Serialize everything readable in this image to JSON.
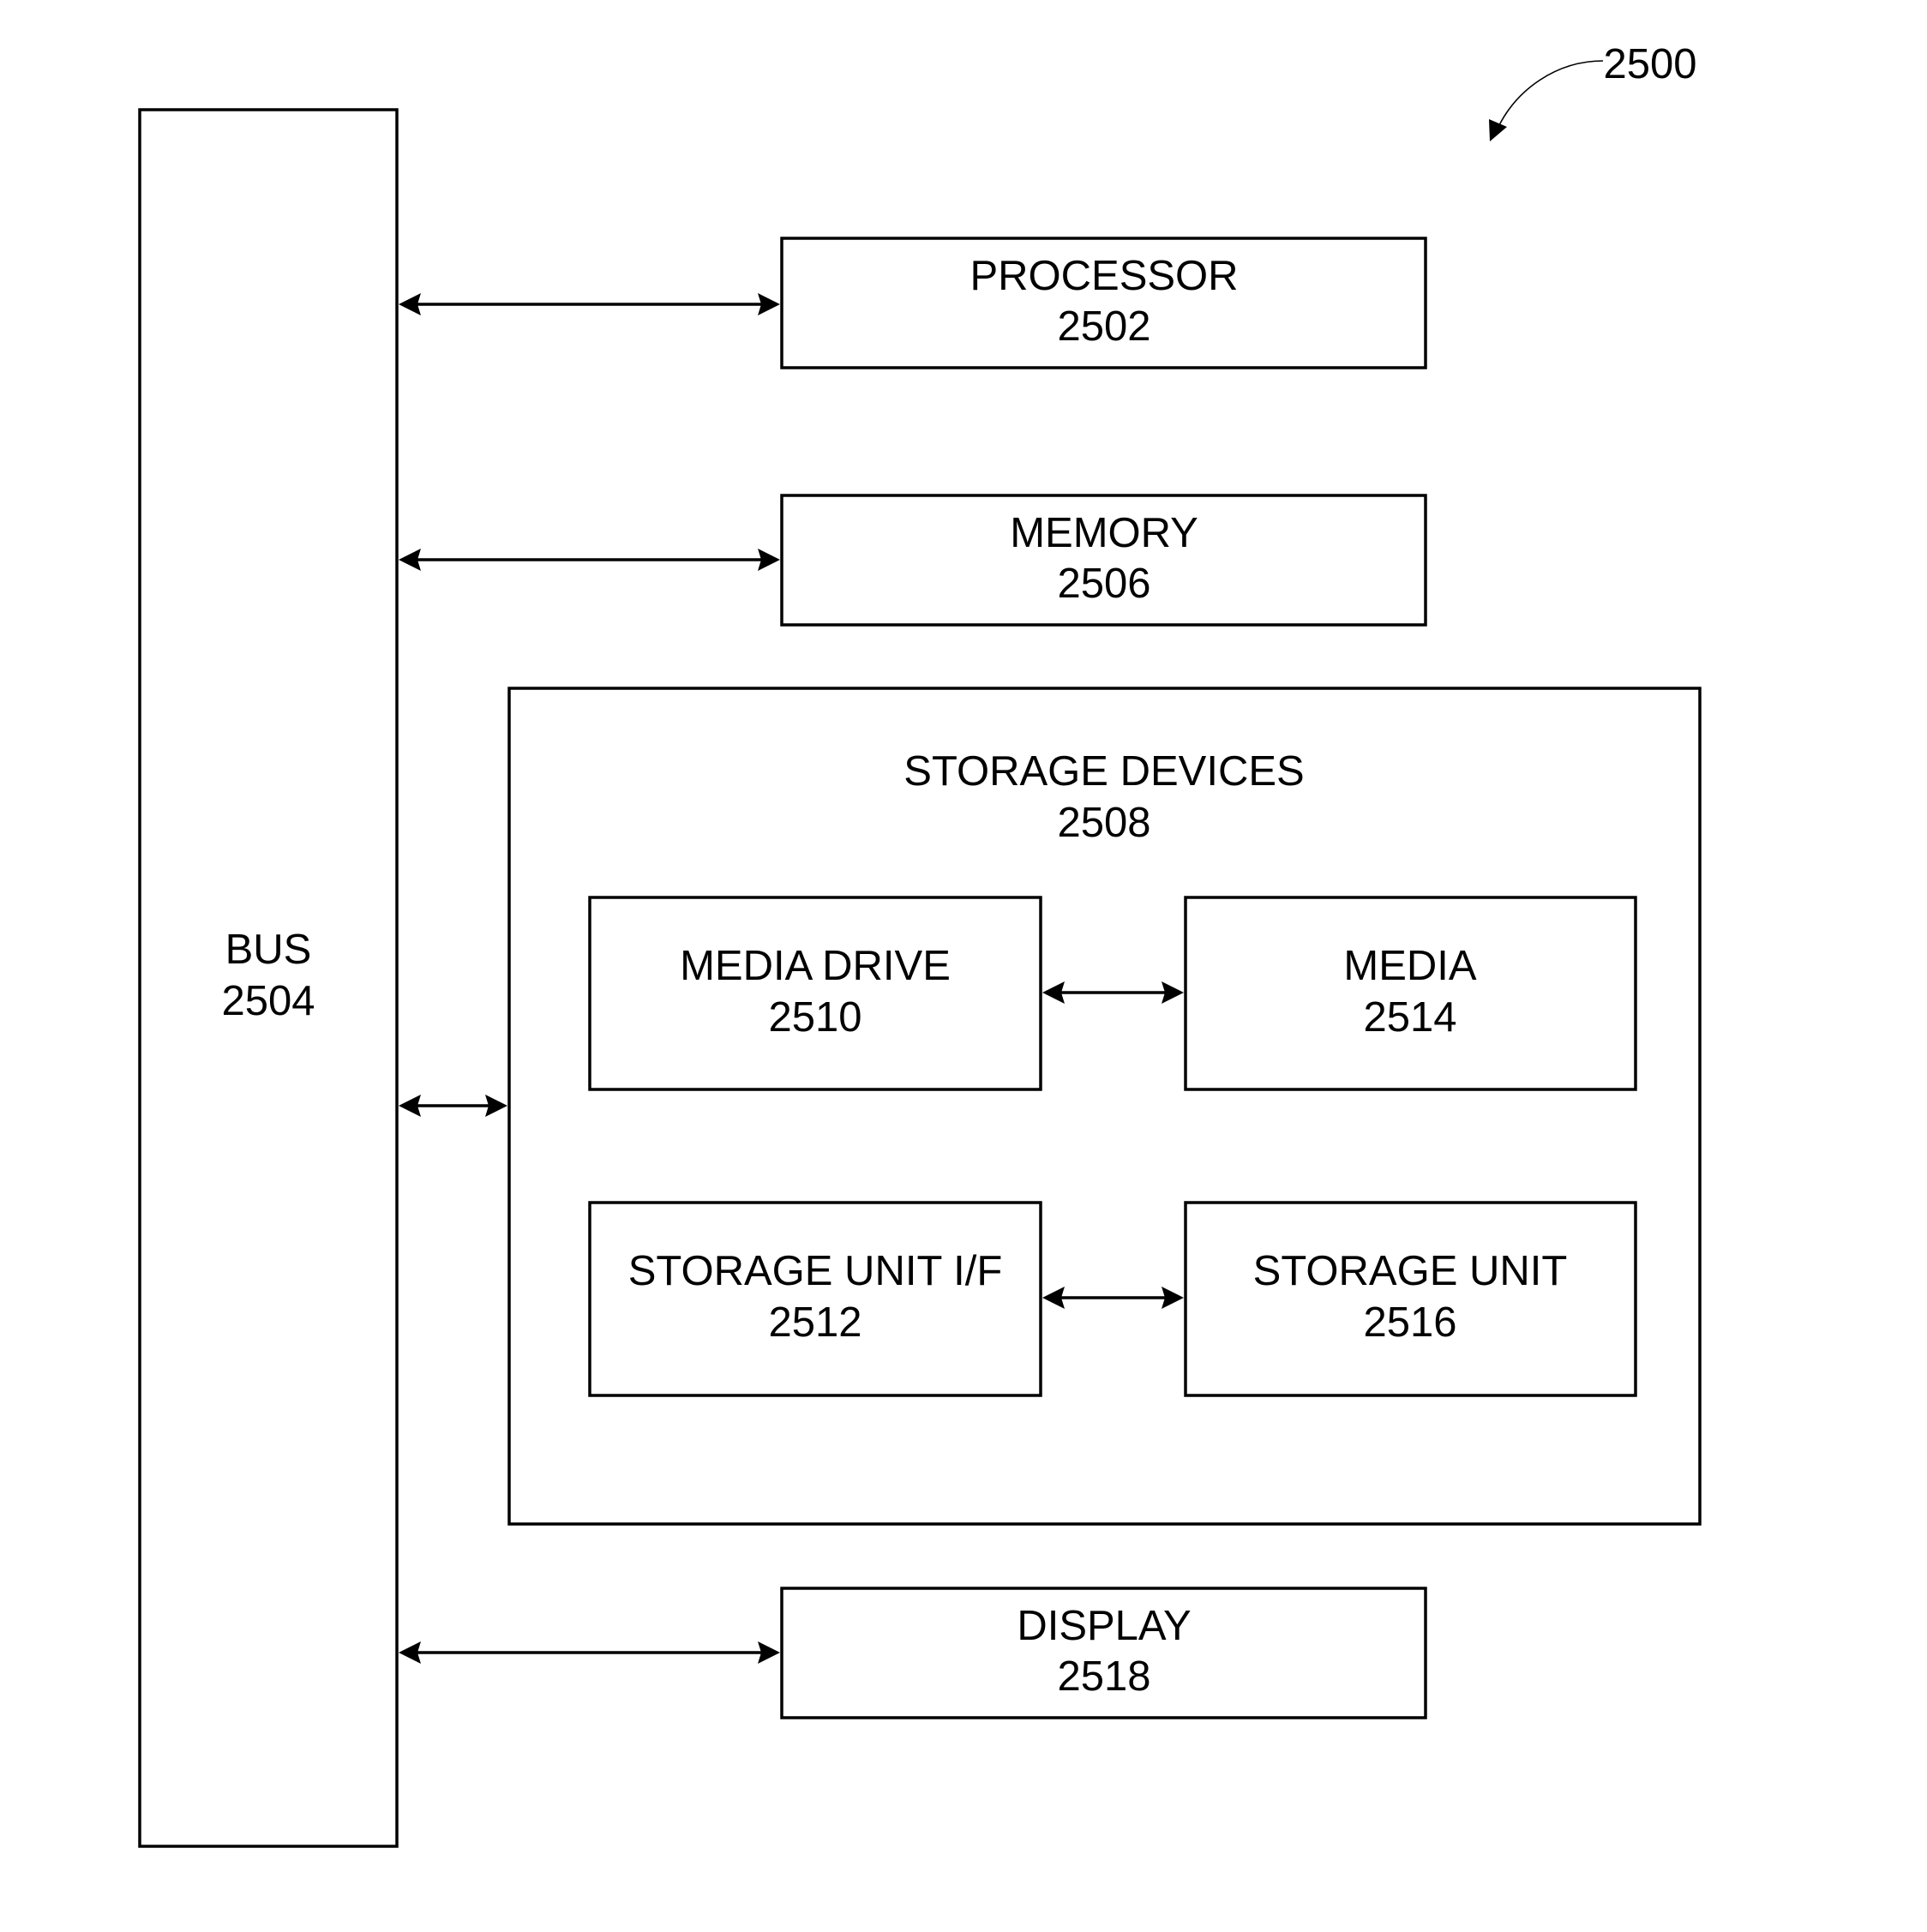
{
  "figure": {
    "reference_label": "2500"
  },
  "components": {
    "bus": {
      "name": "BUS",
      "ref": "2504"
    },
    "processor": {
      "name": "PROCESSOR",
      "ref": "2502"
    },
    "memory": {
      "name": "MEMORY",
      "ref": "2506"
    },
    "storage_devices": {
      "name": "STORAGE DEVICES",
      "ref": "2508"
    },
    "media_drive": {
      "name": "MEDIA DRIVE",
      "ref": "2510"
    },
    "storage_unit_if": {
      "name": "STORAGE UNIT I/F",
      "ref": "2512"
    },
    "media": {
      "name": "MEDIA",
      "ref": "2514"
    },
    "storage_unit": {
      "name": "STORAGE UNIT",
      "ref": "2516"
    },
    "display": {
      "name": "DISPLAY",
      "ref": "2518"
    }
  },
  "connections": [
    {
      "from": "bus",
      "to": "processor",
      "direction": "bidirectional"
    },
    {
      "from": "bus",
      "to": "memory",
      "direction": "bidirectional"
    },
    {
      "from": "bus",
      "to": "storage_devices",
      "direction": "bidirectional"
    },
    {
      "from": "media_drive",
      "to": "media",
      "direction": "bidirectional"
    },
    {
      "from": "storage_unit_if",
      "to": "storage_unit",
      "direction": "bidirectional"
    },
    {
      "from": "bus",
      "to": "display",
      "direction": "bidirectional"
    }
  ],
  "colors": {
    "stroke": "#000000",
    "background": "#ffffff"
  }
}
